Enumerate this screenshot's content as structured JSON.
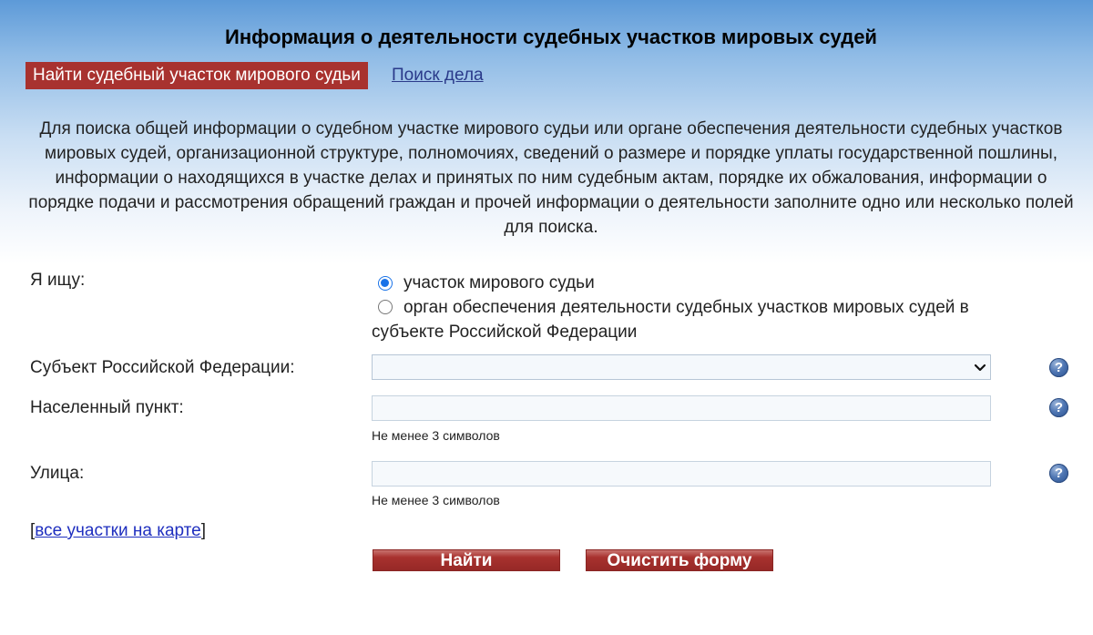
{
  "header": {
    "title": "Информация о деятельности судебных участков мировых судей"
  },
  "tabs": {
    "active_label": "Найти судебный участок мирового судьи",
    "link_label": "Поиск дела"
  },
  "intro": {
    "text": "Для поиска общей информации о судебном участке мирового судьи или органе обеспечения деятельности судебных участков мировых судей, организационной структуре, полномочиях, сведений о размере и порядке уплаты государственной пошлины, информации о находящихся в участке делах и принятых по ним судебным актам, порядке их обжалования, информации о порядке подачи и рассмотрения обращений граждан и прочей информации о деятельности заполните одно или несколько полей для поиска."
  },
  "form": {
    "search_type": {
      "label": "Я ищу:",
      "options": [
        "участок мирового судьи",
        "орган обеспечения деятельности судебных участков мировых судей в субъекте Российской Федерации"
      ],
      "selected_index": 0
    },
    "subject": {
      "label": "Субъект Российской Федерации:",
      "value": ""
    },
    "locality": {
      "label": "Населенный пункт:",
      "value": "",
      "hint": "Не менее 3 символов"
    },
    "street": {
      "label": "Улица:",
      "value": "",
      "hint": "Не менее 3 символов"
    },
    "help_symbol": "?",
    "map_link": {
      "bracket_open": "[",
      "label": "все участки на карте",
      "bracket_close": "]"
    },
    "buttons": {
      "search": "Найти",
      "clear": "Очистить форму"
    }
  },
  "colors": {
    "accent_red": "#a8322f",
    "link_blue": "#1f2fbf"
  }
}
